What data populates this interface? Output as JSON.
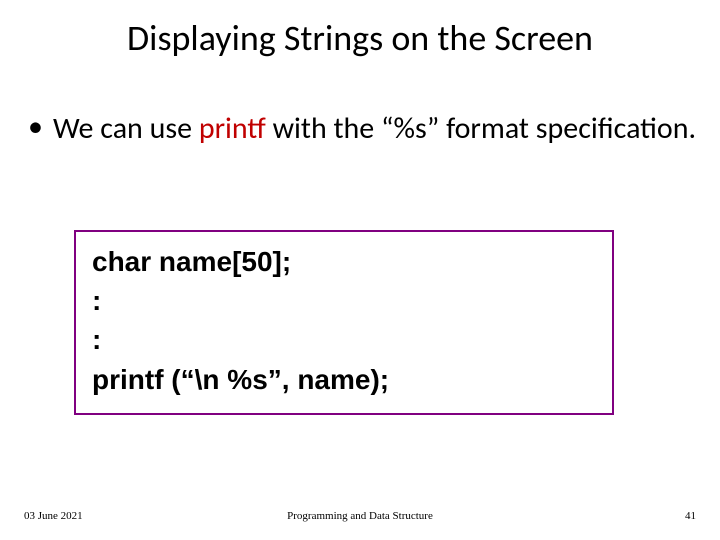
{
  "title": "Displaying Strings on the Screen",
  "bullet": {
    "pre": "We can use ",
    "keyword": "printf",
    "post": " with the “%s” format specification."
  },
  "code": {
    "line1": "char name[50];",
    "line2": ":",
    "line3": ":",
    "line4": "printf (“\\n %s”, name);"
  },
  "footer": {
    "date": "03 June 2021",
    "course": "Programming and Data Structure",
    "page": "41"
  }
}
